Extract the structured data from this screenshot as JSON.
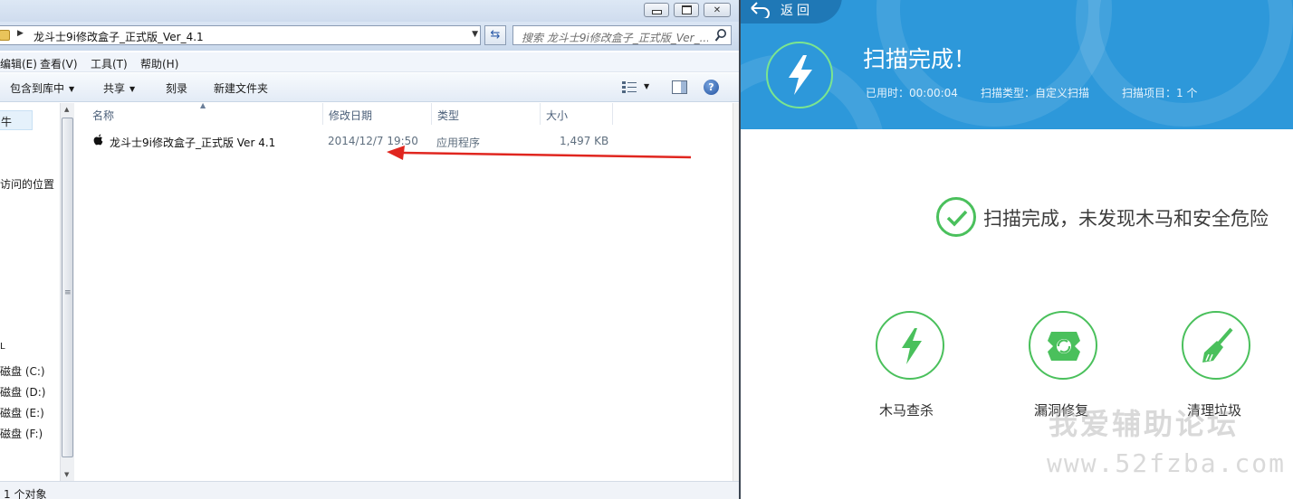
{
  "explorer": {
    "address": "龙斗士9i修改盒子_正式版_Ver_4.1",
    "search_placeholder": "搜索 龙斗士9i修改盒子_正式版_Ver_...",
    "menu": [
      "编辑(E)",
      "查看(V)",
      "工具(T)",
      "帮助(H)"
    ],
    "toolbar": [
      "包含到库中",
      "共享",
      "刻录",
      "新建文件夹"
    ],
    "nav": {
      "items": [
        "访问的位置",
        "磁盘 (C:)",
        "磁盘 (D:)",
        "磁盘 (E:)",
        "磁盘 (F:)"
      ],
      "selected_fragment": "牛",
      "fragment": "L"
    },
    "columns": [
      "名称",
      "修改日期",
      "类型",
      "大小"
    ],
    "files": [
      {
        "name": "龙斗士9i修改盒子_正式版 Ver 4.1",
        "date": "2014/12/7 19:50",
        "type": "应用程序",
        "size": "1,497 KB"
      }
    ],
    "status": "1 个对象"
  },
  "app": {
    "back_label": "返回",
    "header_title": "扫描完成！",
    "stats": [
      "已用时：00:00:04",
      "扫描类型：自定义扫描",
      "扫描项目：1 个"
    ],
    "result_text": "扫描完成，未发现木马和安全危险",
    "features": [
      {
        "label": "木马查杀",
        "icon": "lightning-icon"
      },
      {
        "label": "漏洞修复",
        "icon": "patch-icon"
      },
      {
        "label": "清理垃圾",
        "icon": "broom-icon"
      }
    ],
    "watermark_title": "我爱辅助论坛",
    "watermark_url": "www.52fzba.com",
    "accent_color": "#2d98da",
    "success_color": "#4ac05c"
  }
}
